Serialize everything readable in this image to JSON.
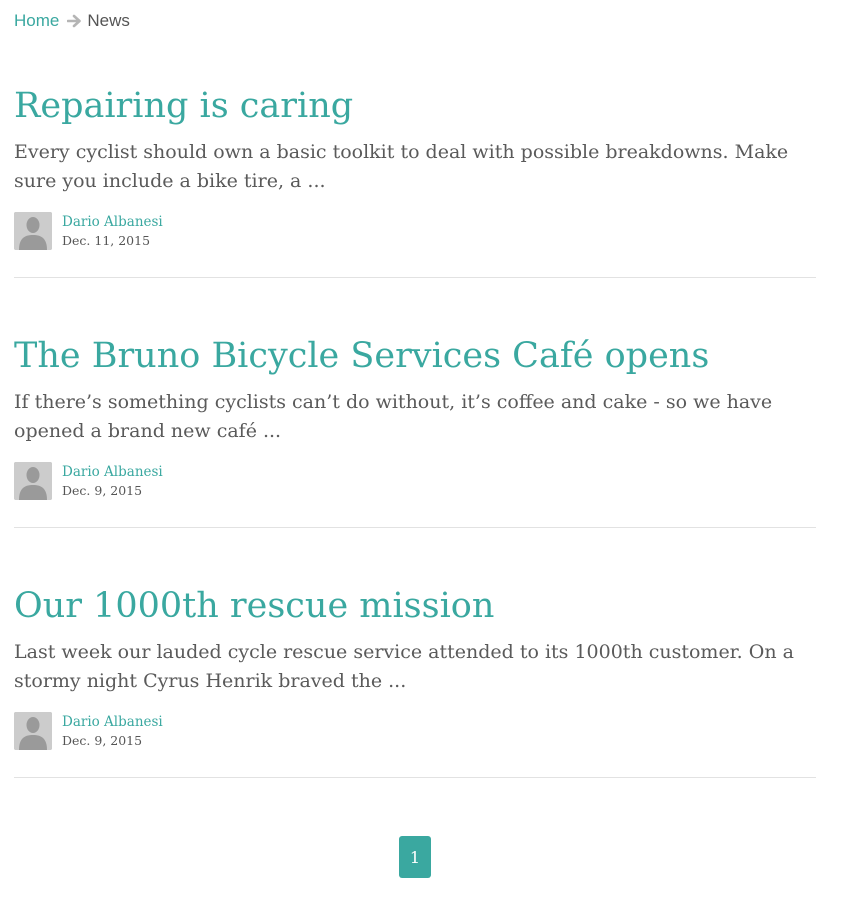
{
  "breadcrumb": {
    "home": "Home",
    "separator_icon": "arrow-right-icon",
    "current": "News"
  },
  "colors": {
    "accent": "#3aa8a0",
    "text": "#555555",
    "divider": "#e2e2e2",
    "avatar_bg": "#cccccc",
    "avatar_silhouette": "#9a9a9a"
  },
  "articles": [
    {
      "title": "Repairing is caring",
      "excerpt": "Every cyclist should own a basic toolkit to deal with possible breakdowns. Make sure you include a bike tire, a ...",
      "author": "Dario Albanesi",
      "date": "Dec. 11, 2015",
      "avatar_icon": "user-silhouette-icon"
    },
    {
      "title": "The Bruno Bicycle Services Café opens",
      "excerpt": "If there’s something cyclists can’t do without, it’s coffee and cake - so we have opened a brand new café ...",
      "author": "Dario Albanesi",
      "date": "Dec. 9, 2015",
      "avatar_icon": "user-silhouette-icon"
    },
    {
      "title": "Our 1000th rescue mission",
      "excerpt": "Last week our lauded cycle rescue service attended to its 1000th customer. On a stormy night Cyrus Henrik braved the ...",
      "author": "Dario Albanesi",
      "date": "Dec. 9, 2015",
      "avatar_icon": "user-silhouette-icon"
    }
  ],
  "pagination": {
    "current_page": "1"
  }
}
